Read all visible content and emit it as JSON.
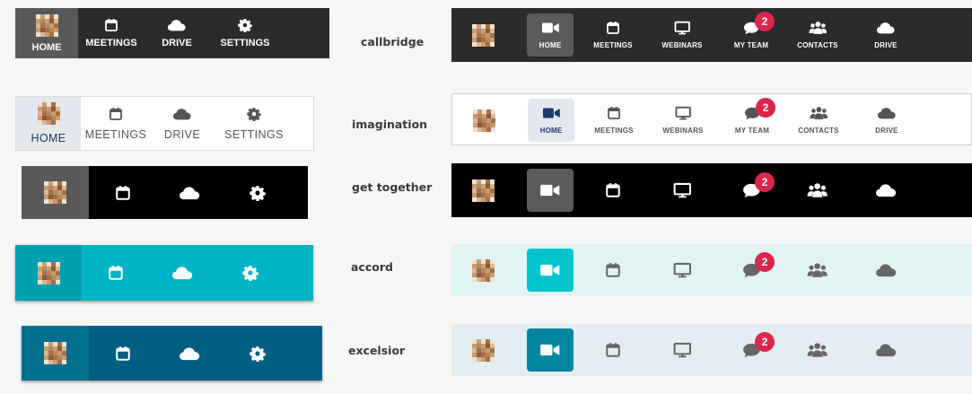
{
  "themes": [
    {
      "name": "callbridge",
      "bg": "#2b2b2b",
      "active_bg": "#595959",
      "fg": "#ffffff",
      "labels": true
    },
    {
      "name": "imagination",
      "bg": "#ffffff",
      "active_bg": "#e2e8ee",
      "fg": "#555555",
      "active_fg": "#1f3560",
      "labels": true
    },
    {
      "name": "get together",
      "bg": "#000000",
      "active_bg": "#595959",
      "fg": "#ffffff",
      "labels": false
    },
    {
      "name": "accord",
      "bg": "#00b4c5",
      "active_bg": "#00a0b0",
      "fg": "#ffffff",
      "labels": false
    },
    {
      "name": "excelsior",
      "bg": "#005e82",
      "active_bg": "#00708f",
      "fg": "#ffffff",
      "labels": false
    }
  ],
  "small_nav": {
    "items": [
      {
        "key": "home",
        "label": "HOME",
        "icon": "avatar-icon"
      },
      {
        "key": "meetings",
        "label": "MEETINGS",
        "icon": "calendar-icon"
      },
      {
        "key": "drive",
        "label": "DRIVE",
        "icon": "cloud-icon"
      },
      {
        "key": "settings",
        "label": "SETTINGS",
        "icon": "gear-icon"
      }
    ]
  },
  "large_nav": {
    "items": [
      {
        "key": "home",
        "label": "HOME",
        "icon": "video-camera-icon"
      },
      {
        "key": "meetings",
        "label": "MEETINGS",
        "icon": "calendar-icon"
      },
      {
        "key": "webinars",
        "label": "WEBINARS",
        "icon": "monitor-icon"
      },
      {
        "key": "my-team",
        "label": "MY TEAM",
        "icon": "chat-icon",
        "badge": "2"
      },
      {
        "key": "contacts",
        "label": "CONTACTS",
        "icon": "people-icon"
      },
      {
        "key": "drive",
        "label": "DRIVE",
        "icon": "cloud-icon"
      }
    ],
    "variants": [
      {
        "bg": "#2b2b2b",
        "active_bg": "#5a5a5a",
        "fg": "#ffffff",
        "active_fg": "#ffffff",
        "labels": true
      },
      {
        "bg": "#ffffff",
        "active_bg": "#e3e8ee",
        "fg": "#555555",
        "active_fg": "#1f3a6e",
        "labels": true
      },
      {
        "bg": "#000000",
        "active_bg": "#5a5a5a",
        "fg": "#ffffff",
        "active_fg": "#ffffff",
        "labels": false
      },
      {
        "bg": "#e2f3f4",
        "active_bg": "#00c3cc",
        "fg": "#666666",
        "active_fg": "#ffffff",
        "labels": false
      },
      {
        "bg": "#e2eef1",
        "active_bg": "#00869f",
        "fg": "#666666",
        "active_fg": "#ffffff",
        "labels": false
      }
    ]
  }
}
